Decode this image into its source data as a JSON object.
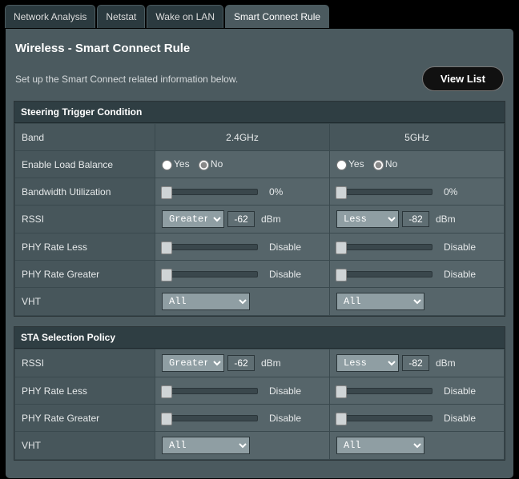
{
  "tabs": {
    "network_analysis": "Network Analysis",
    "netstat": "Netstat",
    "wol": "Wake on LAN",
    "smart_connect": "Smart Connect Rule"
  },
  "page": {
    "title": "Wireless - Smart Connect Rule",
    "subtitle": "Set up the Smart Connect related information below.",
    "view_list": "View List"
  },
  "sections": {
    "trigger": "Steering Trigger Condition",
    "sta": "STA Selection Policy"
  },
  "cols": {
    "band": "Band",
    "g24": "2.4GHz",
    "g5": "5GHz"
  },
  "rows": {
    "enable_lb": "Enable Load Balance",
    "bw_util": "Bandwidth Utilization",
    "rssi": "RSSI",
    "phy_less": "PHY Rate Less",
    "phy_greater": "PHY Rate Greater",
    "vht": "VHT"
  },
  "radio": {
    "yes": "Yes",
    "no": "No"
  },
  "values": {
    "bw_util_24": "0%",
    "bw_util_5": "0%",
    "rssi_24_op": "Greater",
    "rssi_24_val": "-62",
    "rssi_5_op": "Less",
    "rssi_5_val": "-82",
    "dbm": "dBm",
    "phy_less_24": "Disable",
    "phy_less_5": "Disable",
    "phy_greater_24": "Disable",
    "phy_greater_5": "Disable",
    "vht_24": "All",
    "vht_5": "All",
    "sta_rssi_24_op": "Greater",
    "sta_rssi_24_val": "-62",
    "sta_rssi_5_op": "Less",
    "sta_rssi_5_val": "-82",
    "sta_phy_less_24": "Disable",
    "sta_phy_less_5": "Disable",
    "sta_phy_greater_24": "Disable",
    "sta_phy_greater_5": "Disable",
    "sta_vht_24": "All",
    "sta_vht_5": "All"
  }
}
